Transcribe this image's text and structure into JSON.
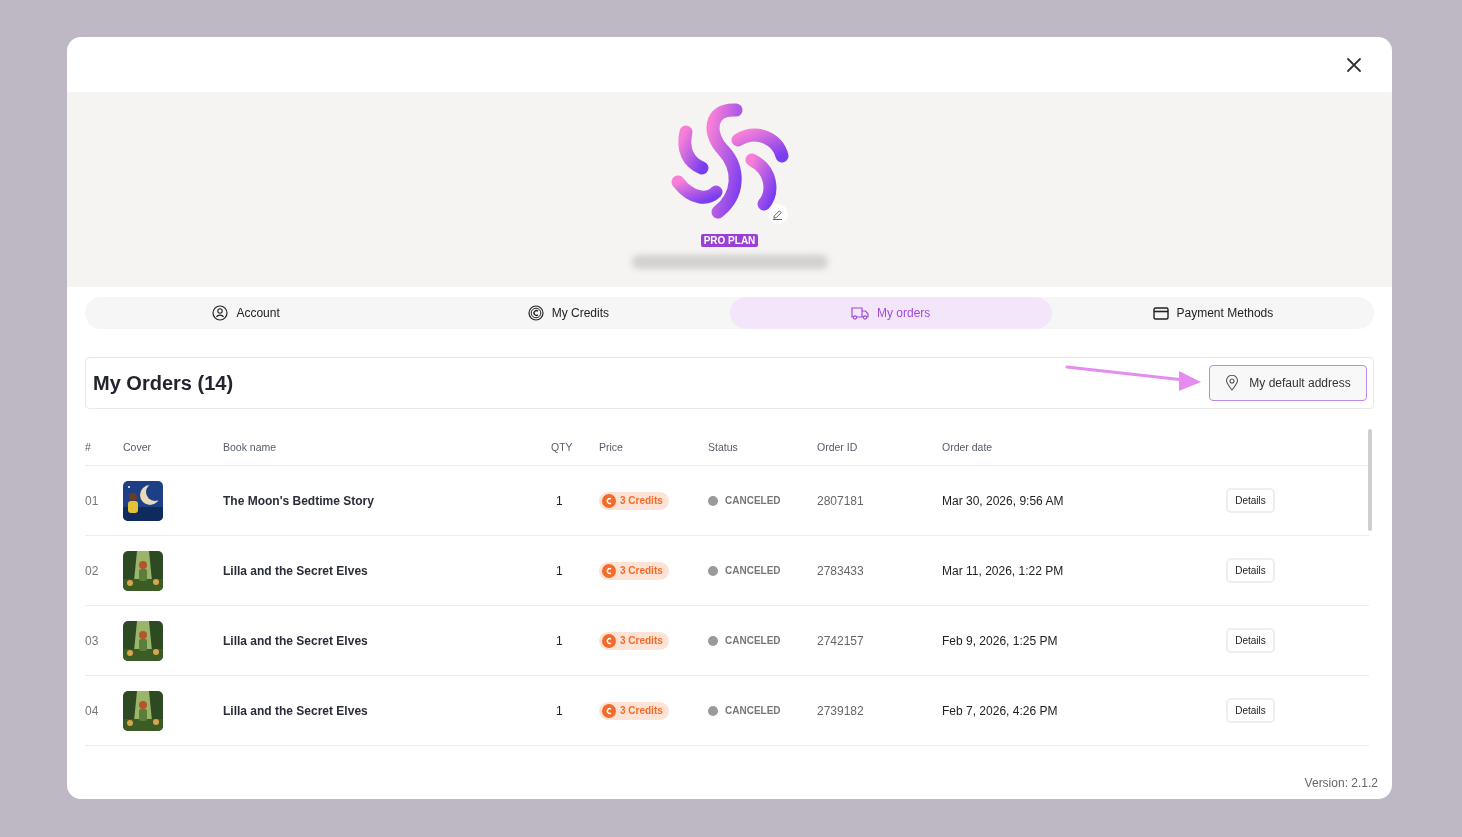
{
  "profile": {
    "badge": "PRO PLAN"
  },
  "tabs": [
    {
      "label": "Account",
      "kind": "account",
      "selected": false
    },
    {
      "label": "My Credits",
      "kind": "credits",
      "selected": false
    },
    {
      "label": "My orders",
      "kind": "orders",
      "selected": true
    },
    {
      "label": "Payment Methods",
      "kind": "payment",
      "selected": false
    }
  ],
  "orders": {
    "title": "My Orders (14)",
    "address_button": "My default address",
    "columns": [
      "#",
      "Cover",
      "Book name",
      "QTY",
      "Price",
      "Status",
      "Order ID",
      "Order date"
    ],
    "rows": [
      {
        "index": "01",
        "book": "The Moon's Bedtime Story",
        "qty": "1",
        "price": "3 Credits",
        "status": "CANCELED",
        "order_id": "2807181",
        "date": "Mar 30, 2026, 9:56 AM",
        "action": "Details"
      },
      {
        "index": "02",
        "book": "Lilla and the Secret Elves",
        "qty": "1",
        "price": "3 Credits",
        "status": "CANCELED",
        "order_id": "2783433",
        "date": "Mar 11, 2026, 1:22 PM",
        "action": "Details"
      },
      {
        "index": "03",
        "book": "Lilla and the Secret Elves",
        "qty": "1",
        "price": "3 Credits",
        "status": "CANCELED",
        "order_id": "2742157",
        "date": "Feb 9, 2026, 1:25 PM",
        "action": "Details"
      },
      {
        "index": "04",
        "book": "Lilla and the Secret Elves",
        "qty": "1",
        "price": "3 Credits",
        "status": "CANCELED",
        "order_id": "2739182",
        "date": "Feb 7, 2026, 4:26 PM",
        "action": "Details"
      }
    ]
  },
  "version": "Version: 2.1.2"
}
